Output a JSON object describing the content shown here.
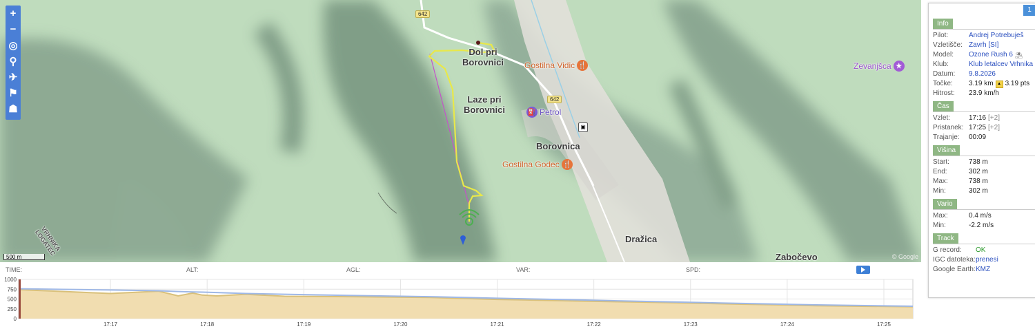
{
  "map": {
    "place_labels": [
      {
        "id": "dol",
        "text": "Dol pri\nBorovnici"
      },
      {
        "id": "laze",
        "text": "Laze pri\nBorovnici"
      },
      {
        "id": "borovnica",
        "text": "Borovnica"
      },
      {
        "id": "drazica",
        "text": "Dražica"
      },
      {
        "id": "zabocevo",
        "text": "Zabočevo"
      },
      {
        "id": "vrhnika",
        "text": "VRHNIKA\nLOGATEC"
      }
    ],
    "pois": [
      {
        "id": "vidic",
        "text": "Gostilna Vidic",
        "icon": "restaurant-icon",
        "color": "#e7743a"
      },
      {
        "id": "petrol",
        "text": "Petrol",
        "icon": "fuel-icon",
        "color": "#7a5ad6"
      },
      {
        "id": "godec",
        "text": "Gostilna Godec",
        "icon": "restaurant-icon",
        "color": "#e7743a"
      },
      {
        "id": "zevanjsca",
        "text": "Zevanjšca",
        "icon": "attraction-icon",
        "color": "#a25bd6"
      }
    ],
    "road_badges": [
      "642",
      "642"
    ],
    "scale": "500 m",
    "copyright": "© Google",
    "track_color": "#e8e84a",
    "straight_line_color": "#c453c9"
  },
  "toolbar": {
    "icons": [
      "zoom-in-icon",
      "zoom-out-icon",
      "locate-icon",
      "marker-icon",
      "plane-icon",
      "flag-icon",
      "group-icon"
    ]
  },
  "panel": {
    "page_badge": "1",
    "info": {
      "title": "Info",
      "rows": [
        {
          "k": "Pilot:",
          "v": "Andrej Potrebuješ",
          "link": true
        },
        {
          "k": "Vzletišče:",
          "v": "Zavrh [SI]",
          "link": true
        },
        {
          "k": "Model:",
          "v": "Ozone Rush 6",
          "link": true
        },
        {
          "k": "Klub:",
          "v": "Klub letalcev Vrhnika",
          "link": true
        },
        {
          "k": "Datum:",
          "v": "9.8.2026",
          "link": true
        },
        {
          "k": "Točke:",
          "v": "3.19 km",
          "v2": "3.19 pts",
          "link": false
        },
        {
          "k": "Hitrost:",
          "v": "23.9 km/h",
          "link": false
        }
      ]
    },
    "cas": {
      "title": "Čas",
      "rows": [
        {
          "k": "Vzlet:",
          "v": "17:16",
          "extra": "[+2]"
        },
        {
          "k": "Pristanek:",
          "v": "17:25",
          "extra": "[+2]"
        },
        {
          "k": "Trajanje:",
          "v": "00:09",
          "extra": ""
        }
      ]
    },
    "visina": {
      "title": "Višina",
      "rows": [
        {
          "k": "Start:",
          "v": "738 m"
        },
        {
          "k": "End:",
          "v": "302 m"
        },
        {
          "k": "Max:",
          "v": "738 m"
        },
        {
          "k": "Min:",
          "v": "302 m"
        }
      ]
    },
    "vario": {
      "title": "Vario",
      "rows": [
        {
          "k": "Max:",
          "v": "0.4 m/s"
        },
        {
          "k": "Min:",
          "v": "-2.2 m/s"
        }
      ]
    },
    "track": {
      "title": "Track",
      "rows": [
        {
          "k": "G record:",
          "v": "OK",
          "cls": "ok"
        },
        {
          "k": "IGC datoteka:",
          "v": "prenesi",
          "cls": "link"
        },
        {
          "k": "Google Earth:",
          "v": "KMZ",
          "cls": "link"
        }
      ]
    }
  },
  "timeline": {
    "labels": [
      "TIME:",
      "ALT:",
      "AGL:",
      "VAR:",
      "SPD:"
    ]
  },
  "chart_data": {
    "type": "area",
    "title": "",
    "xlabel": "",
    "ylabel": "",
    "x_ticks": [
      "17:17",
      "17:18",
      "17:19",
      "17:20",
      "17:21",
      "17:22",
      "17:23",
      "17:24",
      "17:25"
    ],
    "y_ticks": [
      0,
      250,
      500,
      750,
      1000
    ],
    "ylim": [
      0,
      1000
    ],
    "x_minutes": [
      16.05,
      17,
      17.5,
      17.7,
      17.85,
      17.95,
      18.1,
      18.4,
      18.8,
      19.5,
      20.3,
      21,
      21.8,
      22.5,
      23.3,
      24.3,
      25.3
    ],
    "series": [
      {
        "values": [
          738,
          640,
          700,
          580,
          650,
          600,
          580,
          620,
          570,
          560,
          540,
          490,
          450,
          420,
          380,
          330,
          302
        ],
        "color": "#d9c07a"
      },
      {
        "values": [
          760,
          730,
          710,
          690,
          680,
          675,
          665,
          640,
          620,
          590,
          560,
          520,
          480,
          440,
          400,
          350,
          315
        ],
        "color": "#9fb8e6"
      }
    ],
    "grid": true
  }
}
